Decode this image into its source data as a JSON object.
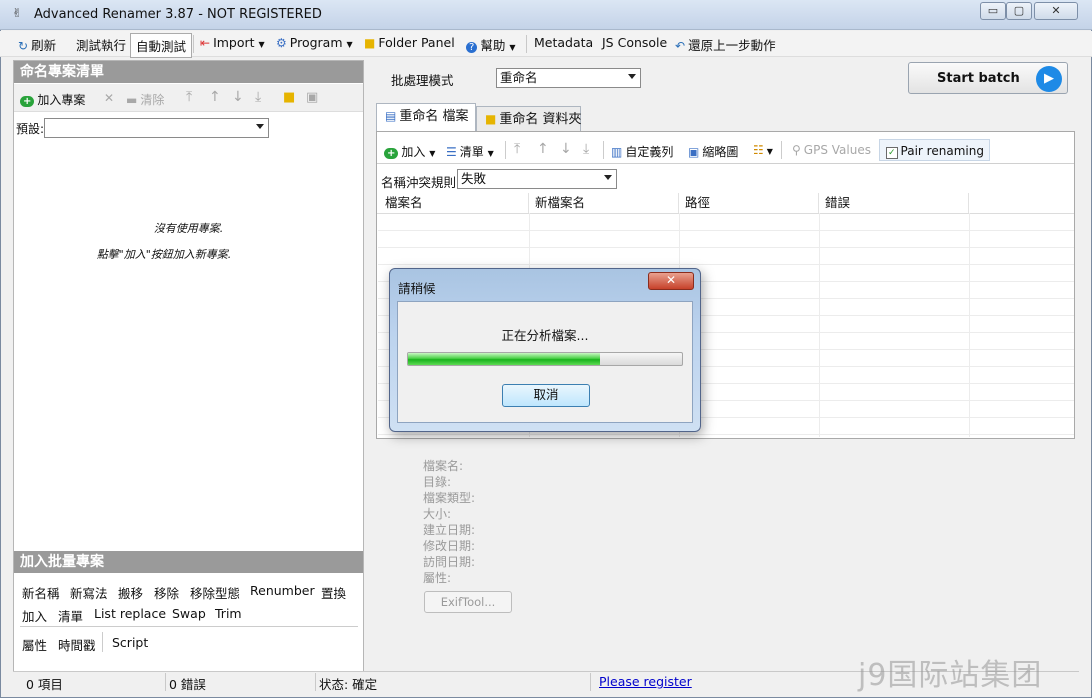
{
  "window": {
    "title": "Advanced Renamer 3.87 - NOT REGISTERED",
    "minimize": "▭",
    "maximize": "▢",
    "close": "✕"
  },
  "toolbar": {
    "refresh": "刷新",
    "test_run": "測試執行",
    "auto_test": "自動測試",
    "import": "Import",
    "program": "Program",
    "folder_panel": "Folder Panel",
    "help": "幫助",
    "metadata": "Metadata",
    "js_console": "JS Console",
    "undo": "還原上一步動作"
  },
  "left": {
    "header": "命名專案清單",
    "add_project": "加入專案",
    "clear": "清除",
    "preset_label": "預設:",
    "preset_value": "",
    "empty_line1": "沒有使用專案.",
    "empty_line2": "點擊\"加入\"按鈕加入新專案.",
    "batch_header": "加入批量專案",
    "methods_row1": [
      "新名稱",
      "新寫法",
      "搬移",
      "移除",
      "移除型態",
      "Renumber",
      "置換"
    ],
    "methods_row2": [
      "加入",
      "清單",
      "List replace",
      "Swap",
      "Trim"
    ],
    "methods_row3": [
      "屬性",
      "時間戳",
      "Script"
    ]
  },
  "batch": {
    "mode_label": "批處理模式",
    "mode_value": "重命名",
    "start_label": "Start batch"
  },
  "tabs": [
    {
      "label": "重命名 檔案"
    },
    {
      "label": "重命名 資料夾"
    }
  ],
  "filetool": {
    "add": "加入",
    "list": "清單",
    "custom": "自定義列",
    "thumbnail": "縮略圖",
    "gps": "GPS Values",
    "pair": "Pair renaming",
    "conflict_label": "名稱沖突規則:",
    "conflict_value": "失敗"
  },
  "columns": [
    "檔案名",
    "新檔案名",
    "路徑",
    "錯誤"
  ],
  "properties": {
    "labels": [
      "檔案名:",
      "目錄:",
      "檔案類型:",
      "大小:",
      "建立日期:",
      "修改日期:",
      "訪問日期:",
      "屬性:"
    ],
    "exif_button": "ExifTool..."
  },
  "dialog": {
    "title": "請稍候",
    "message": "正在分析檔案...",
    "progress": 0.7,
    "cancel": "取消",
    "close": "✕"
  },
  "status": {
    "items": "0 項目",
    "errors": "0 錯誤",
    "state": "状态: 確定",
    "register": "Please register"
  },
  "watermark": "j9国际站集团",
  "colors": {
    "accent": "#1e8ae6",
    "progress": "#18b21c",
    "header": "#9a9a9a"
  }
}
